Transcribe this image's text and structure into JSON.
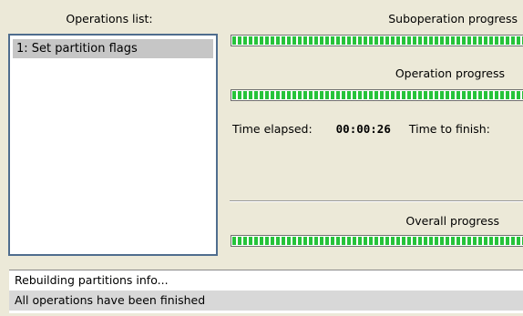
{
  "operations": {
    "title": "Operations list:",
    "items": [
      "1: Set partition flags"
    ]
  },
  "suboperation": {
    "label": "Suboperation progress",
    "progress_percent": 100
  },
  "operation": {
    "label": "Operation progress",
    "progress_percent": 100
  },
  "timing": {
    "elapsed_label": "Time elapsed:",
    "elapsed_value": "00:00:26",
    "finish_label": "Time to finish:"
  },
  "overall": {
    "label": "Overall progress",
    "progress_percent": 100
  },
  "log": {
    "lines": [
      "Rebuilding partitions info...",
      "All operations have been finished"
    ]
  },
  "colors": {
    "progress_fill": "#26c33a",
    "list_border": "#4f6d8e",
    "window_bg": "#ece9d8"
  }
}
